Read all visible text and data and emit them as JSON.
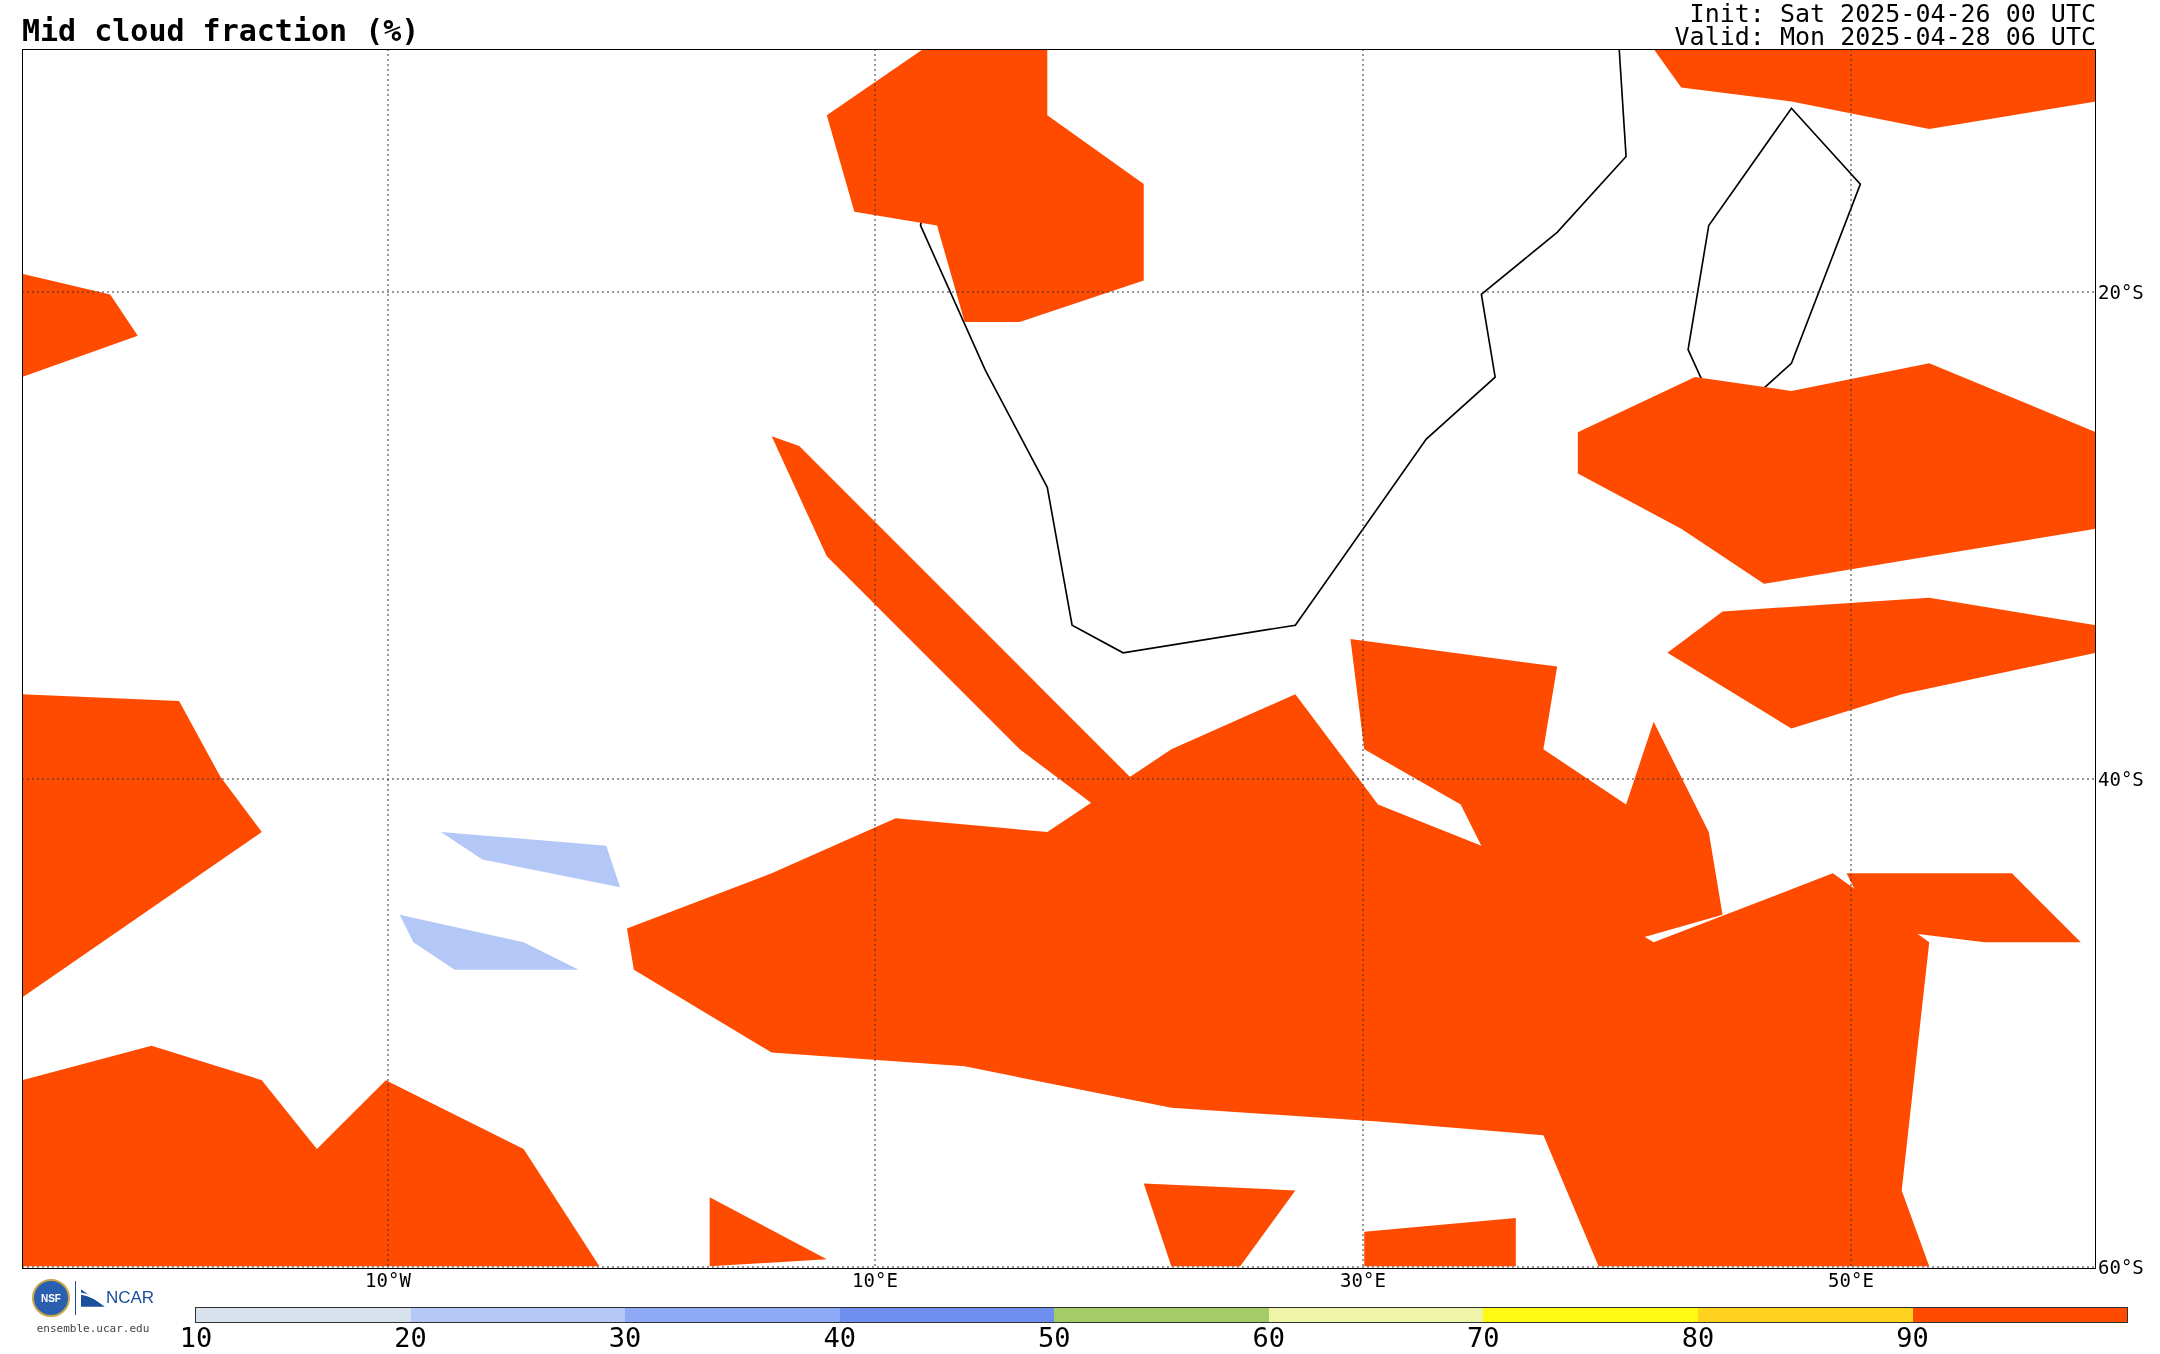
{
  "title": "Mid cloud fraction (%)",
  "init": "Init: Sat 2025-04-26 00 UTC",
  "valid": "Valid: Mon 2025-04-28 06 UTC",
  "map": {
    "lat_labels": [
      "20°S",
      "40°S",
      "60°S"
    ],
    "lon_labels": [
      "10°W",
      "10°E",
      "30°E",
      "50°E"
    ]
  },
  "logos": {
    "nsf": "NSF",
    "ncar": "NCAR",
    "url": "ensemble.ucar.edu"
  },
  "colorbar": [
    {
      "label": "10",
      "color": "#d8e2ec"
    },
    {
      "label": "20",
      "color": "#b4c8f8"
    },
    {
      "label": "30",
      "color": "#8eaaf6"
    },
    {
      "label": "40",
      "color": "#6f8ff0"
    },
    {
      "label": "50",
      "color": "#a3cc66"
    },
    {
      "label": "60",
      "color": "#eef5a8"
    },
    {
      "label": "70",
      "color": "#fffa14"
    },
    {
      "label": "80",
      "color": "#ffd21f"
    },
    {
      "label": "90",
      "color": "#ff4b00"
    }
  ]
}
